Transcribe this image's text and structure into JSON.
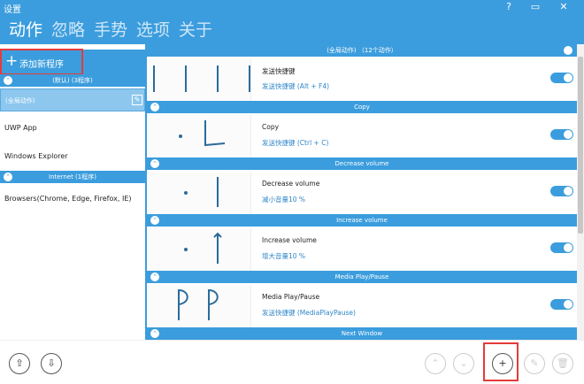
{
  "window": {
    "title": "设置",
    "help": "?",
    "restore": "▭",
    "close": "✕"
  },
  "tabs": [
    {
      "label": "动作",
      "active": true
    },
    {
      "label": "忽略"
    },
    {
      "label": "手势"
    },
    {
      "label": "选项"
    },
    {
      "label": "关于"
    }
  ],
  "sidebar": {
    "add_label": "添加新程序",
    "groups": [
      {
        "label": "(默认) (3程序)"
      },
      {
        "label": "Internet (1程序)"
      }
    ],
    "items": [
      {
        "label": "(全局动作)",
        "selected": true
      },
      {
        "label": "UWP App"
      },
      {
        "label": "Windows Explorer"
      },
      {
        "label": "Browsers(Chrome, Edge, Firefox, IE)"
      }
    ]
  },
  "main": {
    "global_header": "(全局动作)  （12个动作）",
    "actions": [
      {
        "header": "",
        "name": "发送快捷键",
        "desc": "发送快捷键 (Alt + F4)",
        "enabled": true
      },
      {
        "header": "Copy",
        "name": "Copy",
        "desc": "发送快捷键 (Ctrl + C)",
        "enabled": true
      },
      {
        "header": "Decrease volume",
        "name": "Decrease volume",
        "desc": "减小音量10 %",
        "enabled": true
      },
      {
        "header": "Increase volume",
        "name": "Increase volume",
        "desc": "增大音量10 %",
        "enabled": true
      },
      {
        "header": "Media Play/Pause",
        "name": "Media Play/Pause",
        "desc": "发送快捷键 (MediaPlayPause)",
        "enabled": true
      },
      {
        "header": "Next Window",
        "name": "",
        "desc": "",
        "enabled": true
      }
    ]
  },
  "colors": {
    "accent": "#3b9ddd",
    "highlight": "#e53b3b"
  }
}
